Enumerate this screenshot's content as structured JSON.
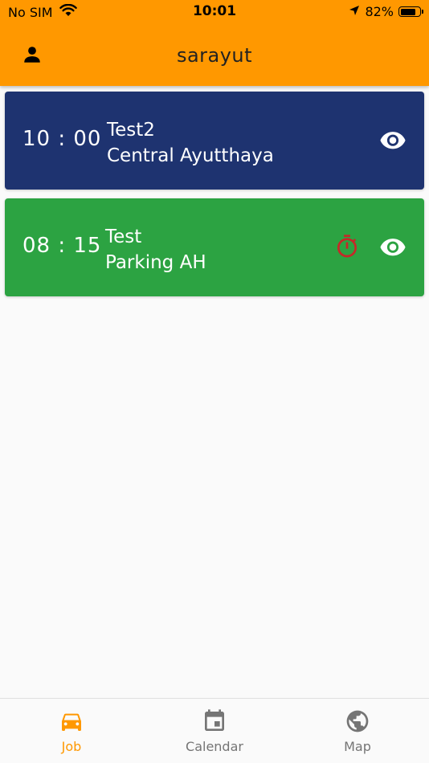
{
  "status_bar": {
    "carrier": "No SIM",
    "time": "10:01",
    "battery": "82%"
  },
  "header": {
    "title": "sarayut"
  },
  "jobs": [
    {
      "time": "10 : 00",
      "title": "Test2",
      "location": "Central Ayutthaya",
      "color": "#1e3370",
      "has_timer": false
    },
    {
      "time": "08 : 15",
      "title": "Test",
      "location": "Parking AH",
      "color": "#2ca342",
      "has_timer": true
    }
  ],
  "bottom_nav": {
    "items": [
      {
        "label": "Job",
        "icon": "car-icon",
        "active": true
      },
      {
        "label": "Calendar",
        "icon": "calendar-icon",
        "active": false
      },
      {
        "label": "Map",
        "icon": "globe-icon",
        "active": false
      }
    ]
  },
  "colors": {
    "accent": "#ff9800",
    "nav_inactive": "#757575",
    "timer": "#c62828"
  }
}
